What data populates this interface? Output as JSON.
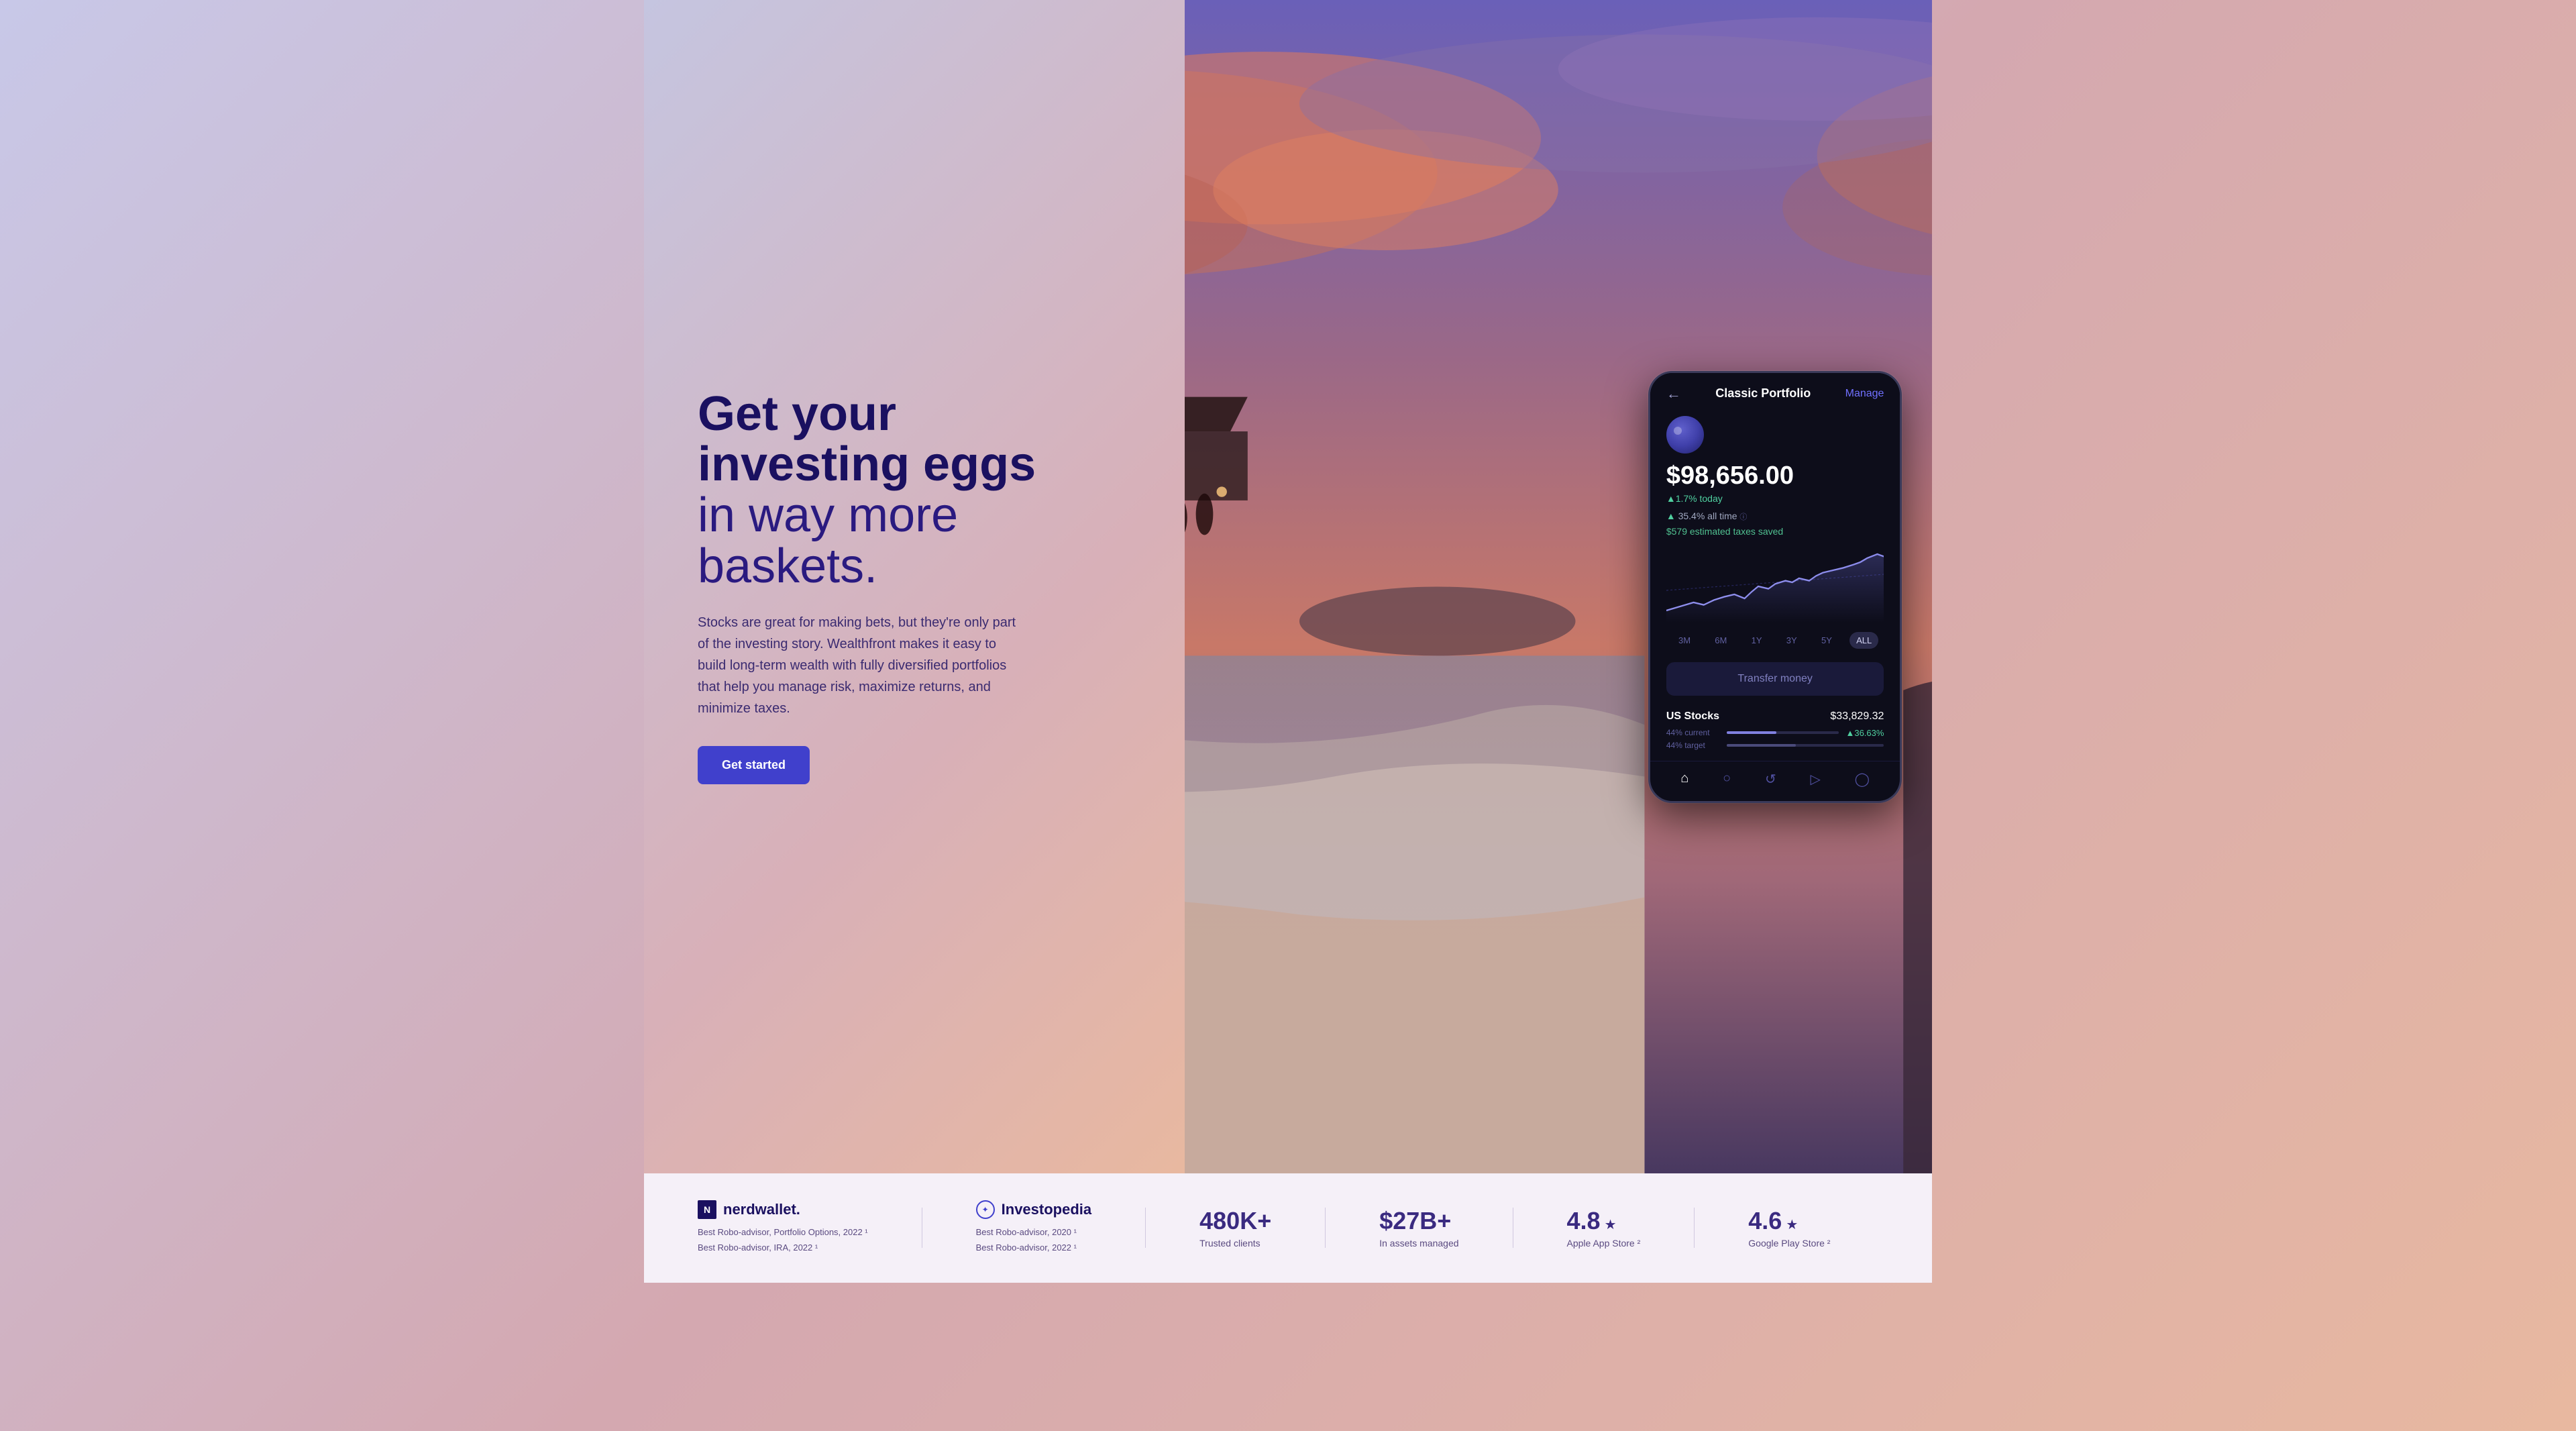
{
  "hero": {
    "headline_line1": "Get your",
    "headline_line2": "investing eggs",
    "headline_line3": "in way more",
    "headline_line4": "baskets.",
    "description": "Stocks are great for making bets, but they're only part of the investing story. Wealthfront makes it easy to build long-term wealth with fully diversified portfolios that help you manage risk, maximize returns, and minimize taxes.",
    "cta_label": "Get started"
  },
  "phone": {
    "title": "Classic Portfolio",
    "manage_label": "Manage",
    "portfolio_value": "$98,656.00",
    "today_change": "▲1.7% today",
    "all_time_label": "35.4% all time",
    "all_time_prefix": "▲",
    "taxes_label": "$579 estimated taxes saved",
    "transfer_btn": "Transfer money",
    "time_ranges": [
      "3M",
      "6M",
      "1Y",
      "3Y",
      "5Y",
      "ALL"
    ],
    "active_range": "ALL",
    "holdings": [
      {
        "name": "US Stocks",
        "value": "$33,829.32",
        "current_pct": "44% current",
        "target_pct": "44% target",
        "change": "▲36.63%"
      }
    ],
    "nav_icons": [
      "⌂",
      "🔍",
      "↺",
      "✈",
      "👤"
    ]
  },
  "social_proof": {
    "nerdwallet": {
      "name": "nerdwallet.",
      "awards": [
        "Best Robo-advisor, Portfolio Options, 2022 ¹",
        "Best Robo-advisor, IRA, 2022 ¹"
      ]
    },
    "investopedia": {
      "name": "Investopedia",
      "awards": [
        "Best Robo-advisor, 2020 ¹",
        "Best Robo-advisor, 2022 ¹"
      ]
    },
    "stat1": {
      "number": "480K+",
      "label": "Trusted clients"
    },
    "stat2": {
      "number": "$27B+",
      "label": "In assets managed"
    },
    "stat3": {
      "number": "4.8",
      "label": "Apple App Store ²",
      "star": "★"
    },
    "stat4": {
      "number": "4.6",
      "label": "Google Play Store ²",
      "star": "★"
    }
  },
  "colors": {
    "primary": "#4040cc",
    "headline": "#1a1060",
    "positive": "#50d0a0",
    "phone_bg": "#0d0d1a",
    "accent_purple": "#7070ff"
  }
}
